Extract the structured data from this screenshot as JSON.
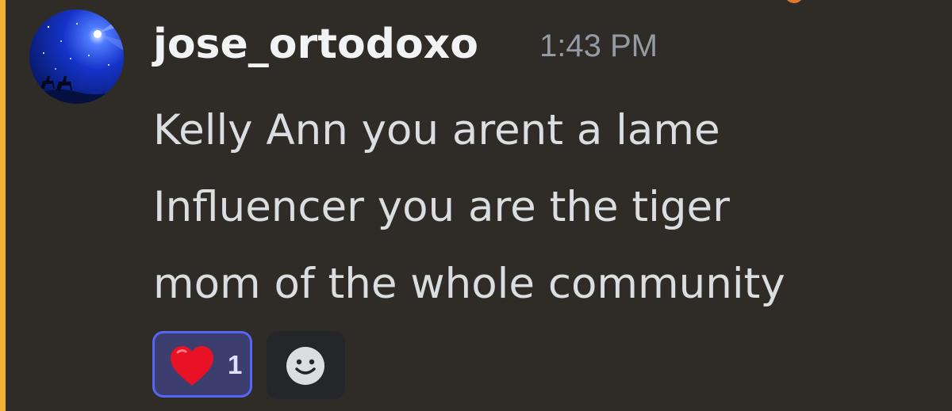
{
  "message": {
    "author": "jose_ortodoxo",
    "timestamp": "1:43 PM",
    "content_lines": [
      "Kelly Ann you arent a lame",
      "Influencer you are the tiger",
      "mom of the whole community"
    ],
    "mentioned": true
  },
  "reactions": [
    {
      "emoji": "heart-emoji",
      "count": "1",
      "selected": true
    }
  ],
  "add_reaction": {
    "icon": "smile-icon"
  },
  "colors": {
    "background": "#2f2c28",
    "mention_bar": "#f0b232",
    "username": "#f2f3f5",
    "timestamp": "#949ba4",
    "text": "#dbdee1",
    "reaction_border": "#5865f2",
    "reaction_bg": "#3b3e6e",
    "add_reaction_bg": "#25262a"
  }
}
